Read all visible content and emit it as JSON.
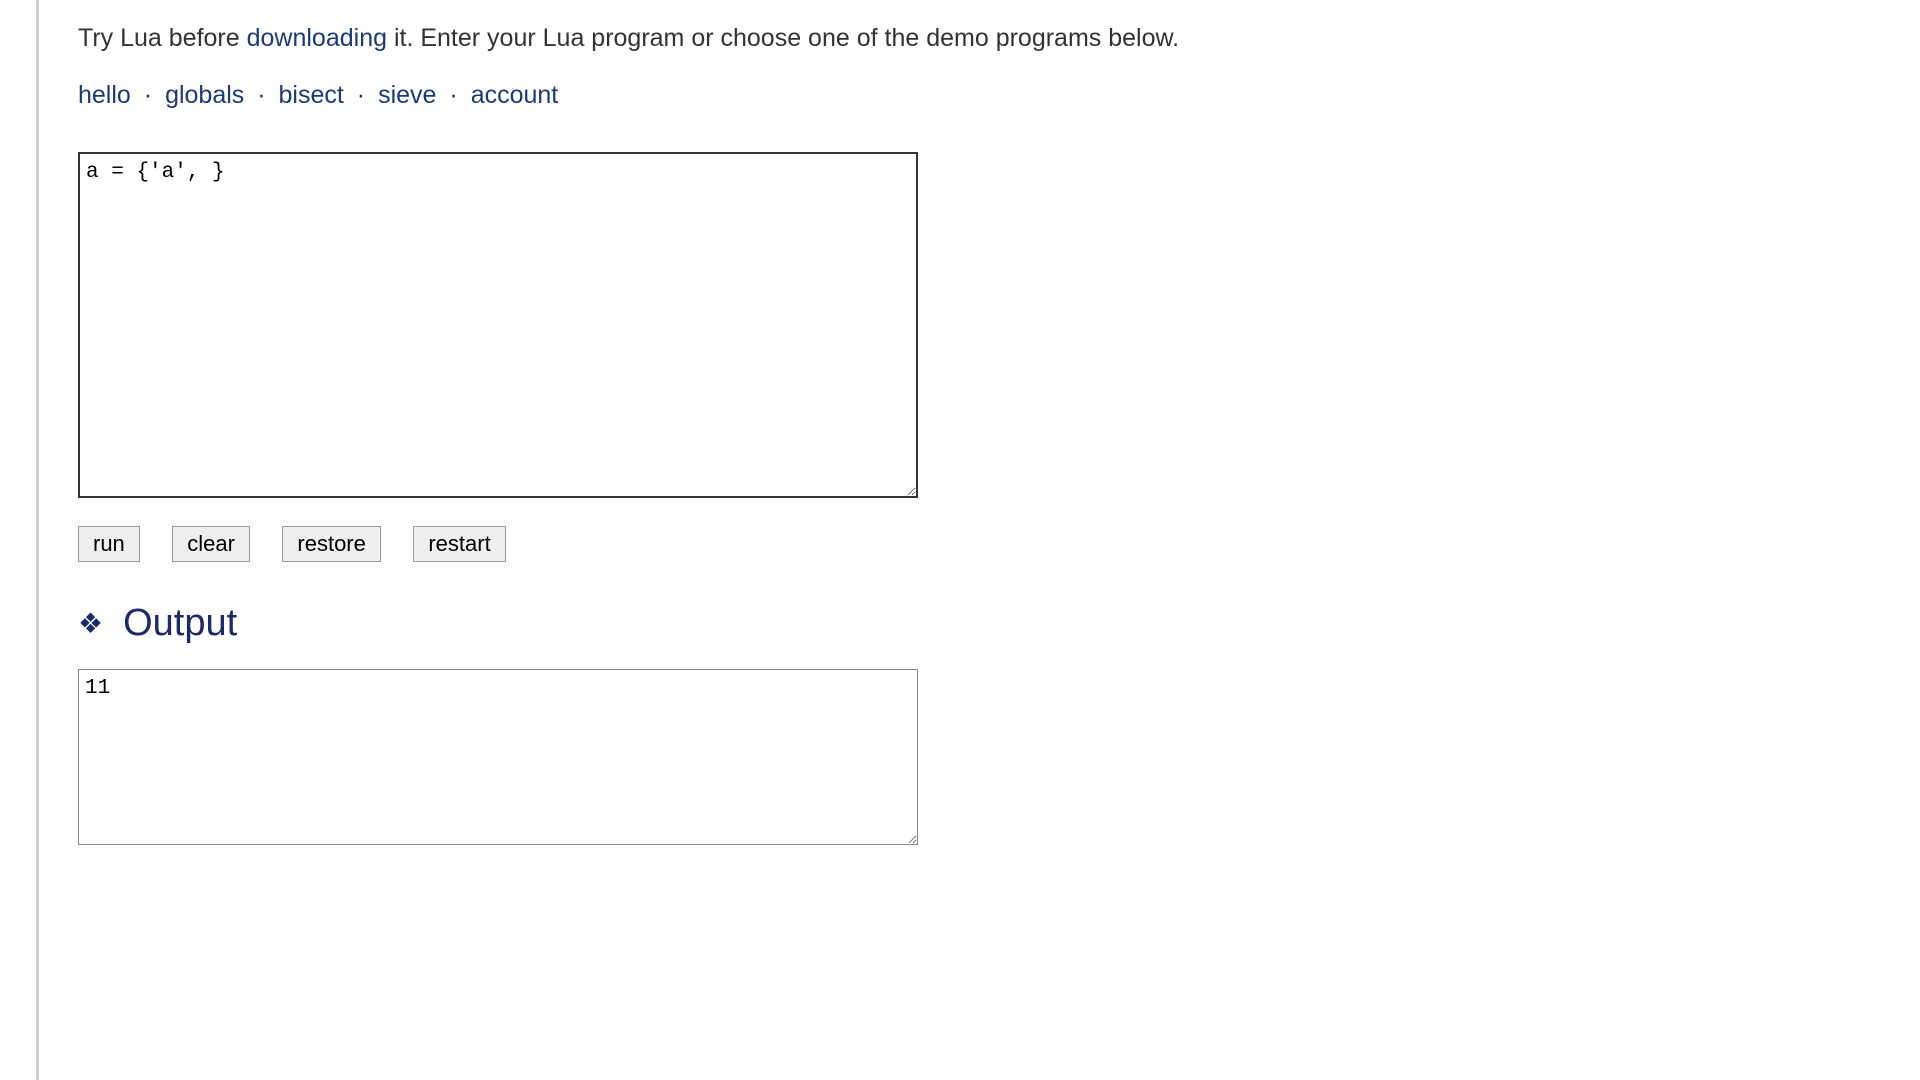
{
  "intro": {
    "prefix": "Try Lua before ",
    "link": "downloading",
    "suffix": " it. Enter your Lua program or choose one of the demo programs below."
  },
  "demos": {
    "items": [
      "hello",
      "globals",
      "bisect",
      "sieve",
      "account"
    ],
    "separator": "·"
  },
  "code": "a = {'a', }",
  "buttons": {
    "run": "run",
    "clear": "clear",
    "restore": "restore",
    "restart": "restart"
  },
  "output": {
    "heading": "Output",
    "text": "11"
  }
}
